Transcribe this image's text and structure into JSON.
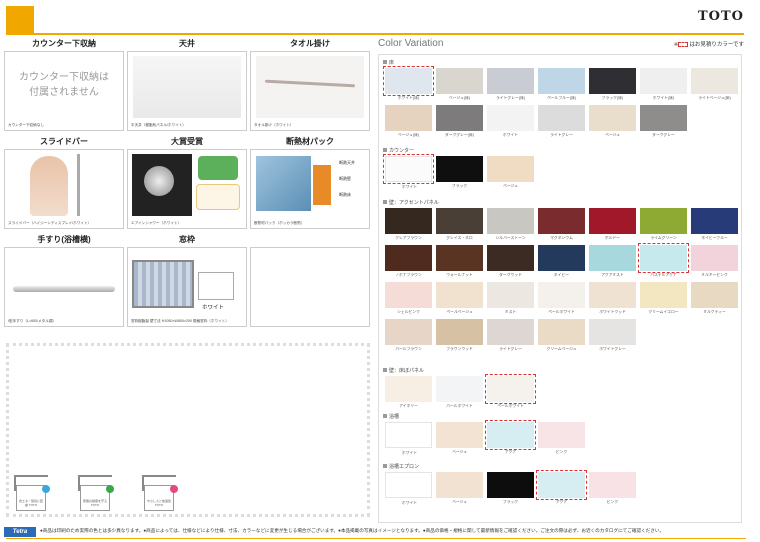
{
  "header": {
    "brand": "TOTO"
  },
  "features": [
    {
      "title": "カウンター下収納",
      "caption": "カウンター下収納なし",
      "text_line1": "カウンター下収納は",
      "text_line2": "付属されません"
    },
    {
      "title": "天井",
      "caption": "平天井（樹脂系パネル/ホワイト）"
    },
    {
      "title": "タオル掛け",
      "caption": "タオル掛け（ホワイト）"
    },
    {
      "title": "スライドバー",
      "caption": "スライドバー（ハイジーンディスプレイ/ホワイト）"
    },
    {
      "title": "大賞受賞",
      "caption": "エアインシャワー（ホワイト）"
    },
    {
      "title": "断熱材パック",
      "caption": "断熱材パック（ホッカラ断熱）",
      "labels": [
        "断熱天井",
        "断熱壁",
        "断熱床"
      ]
    },
    {
      "title": "手すり(浴槽横)",
      "caption": "I型手すり（L=600/メタル調）"
    },
    {
      "title": "窓枠",
      "caption": "窓枠樹脂製 壁寸法 H1050×W800×200 規格窓枠（ホワイト）",
      "swatch_label": "ホワイト"
    }
  ],
  "houses": [
    {
      "lines": "省エネ・環境に配慮 TOTO",
      "dot": "#3aa8d8"
    },
    {
      "lines": "家族の健康を守る TOTO",
      "dot": "#3aa84a"
    },
    {
      "lines": "やさしさと快適性 TOTO",
      "dot": "#e54a7a"
    }
  ],
  "color_variation": {
    "title": "Color Variation",
    "note": "はお見積りカラーです",
    "sections": [
      {
        "label": "床",
        "rows": [
          [
            {
              "name": "ホワイト(床)",
              "color": "#dfe6ee",
              "sel": true
            },
            {
              "name": "ベージュ(床)",
              "color": "#d9d6cf"
            },
            {
              "name": "ライトグレー(床)",
              "color": "#c9ccd2"
            },
            {
              "name": "ペールブルー(床)",
              "color": "#bfd6e6"
            },
            {
              "name": "ブラック(床)",
              "color": "#2f2f33"
            },
            {
              "name": "ホワイト(床)",
              "color": "#efefef"
            },
            {
              "name": "ライトベージュ(床)",
              "color": "#ece8df"
            }
          ],
          [
            {
              "name": "ベージュ(床)",
              "color": "#e6d3bf"
            },
            {
              "name": "ダークグレー(床)",
              "color": "#7d7b7b"
            },
            {
              "name": "ホワイト",
              "color": "#f3f3f3"
            },
            {
              "name": "ライトグレー",
              "color": "#dcdcdc"
            },
            {
              "name": "ベージュ",
              "color": "#e9ddcc"
            },
            {
              "name": "ダークグレー",
              "color": "#8f8c8c"
            }
          ]
        ]
      },
      {
        "label": "カウンター",
        "rows": [
          [
            {
              "name": "ホワイト",
              "color": "#fbfbfb",
              "sel": true
            },
            {
              "name": "ブラック",
              "color": "#0f0f0f"
            },
            {
              "name": "ベージュ",
              "color": "#f0dcc3"
            }
          ]
        ]
      },
      {
        "label": "壁：アクセントパネル",
        "rows": [
          [
            {
              "name": "クレアブラウン",
              "color": "#35281f"
            },
            {
              "name": "グレイス・ネロ",
              "color": "#4a3f37"
            },
            {
              "name": "シルバーストーン",
              "color": "#c9c7c2"
            },
            {
              "name": "マグネシウム",
              "color": "#7a2b2e"
            },
            {
              "name": "ボルドー",
              "color": "#a0182a"
            },
            {
              "name": "ライムグリーン",
              "color": "#8faa33"
            },
            {
              "name": "ネイビーブルー",
              "color": "#263b78"
            }
          ],
          [
            {
              "name": "ノボナブラウン",
              "color": "#4e2b1e"
            },
            {
              "name": "ウォールナット",
              "color": "#5a3422"
            },
            {
              "name": "ダークウッド",
              "color": "#3c2b22"
            },
            {
              "name": "ネイビー",
              "color": "#233a5c"
            },
            {
              "name": "アクアミスト",
              "color": "#a7d8de"
            },
            {
              "name": "パステルアクア",
              "color": "#c6e9ee",
              "sel": true
            },
            {
              "name": "ミルキーピンク",
              "color": "#f2d3dc"
            }
          ],
          [
            {
              "name": "シェルピンク",
              "color": "#f6dcd6"
            },
            {
              "name": "ペールベージュ",
              "color": "#f1e1cf"
            },
            {
              "name": "ミスト",
              "color": "#ece7e1"
            },
            {
              "name": "ペールホワイト",
              "color": "#f4f1ec"
            },
            {
              "name": "ホワイトウッド",
              "color": "#efe2d2"
            },
            {
              "name": "クリームイエロー",
              "color": "#f3e7c2"
            },
            {
              "name": "ミルクティー",
              "color": "#e8d9c3"
            }
          ],
          [
            {
              "name": "パールブラウン",
              "color": "#e7d5c7"
            },
            {
              "name": "ブラウンウッド",
              "color": "#d7c1a5"
            },
            {
              "name": "ライトグレー",
              "color": "#ddd6d2"
            },
            {
              "name": "クリームベージュ",
              "color": "#eadbc6"
            },
            {
              "name": "ホワイトグレー",
              "color": "#e6e4e3"
            }
          ]
        ]
      },
      {
        "label": "壁：床ぼパネル",
        "rows": [
          [
            {
              "name": "アイボリー",
              "color": "#f7efe4"
            },
            {
              "name": "パールホワイト",
              "color": "#f3f4f6"
            },
            {
              "name": "ペールホワイト",
              "color": "#f5f2ee",
              "sel": true
            }
          ]
        ]
      },
      {
        "label": "浴槽",
        "rows": [
          [
            {
              "name": "ホワイト",
              "color": "#ffffff"
            },
            {
              "name": "ベージュ",
              "color": "#f3e3d2"
            },
            {
              "name": "アクア",
              "color": "#d6eef2",
              "sel": true
            },
            {
              "name": "ピンク",
              "color": "#f8e3e6"
            }
          ]
        ]
      },
      {
        "label": "浴槽エプロン",
        "rows": [
          [
            {
              "name": "ホワイト",
              "color": "#ffffff"
            },
            {
              "name": "ベージュ",
              "color": "#f2e2d1"
            },
            {
              "name": "ブラック",
              "color": "#0d0d0d"
            },
            {
              "name": "アクア",
              "color": "#d6eef2",
              "sel": true
            },
            {
              "name": "ピンク",
              "color": "#f8e2e5"
            }
          ]
        ]
      }
    ]
  },
  "footer": {
    "logo": "Tetra",
    "text": "●商品は印刷のため実際の色とは多少異なります。●商品によっては、仕様などにより仕様、寸法、カラーなどに変更が生じる場合がございます。●本品掲載の写真はイメージとなります。●商品の価格・規格に関して最新情報をご確認ください。ご注文の際は必ず、お近くのカタログにてご確認ください。"
  }
}
